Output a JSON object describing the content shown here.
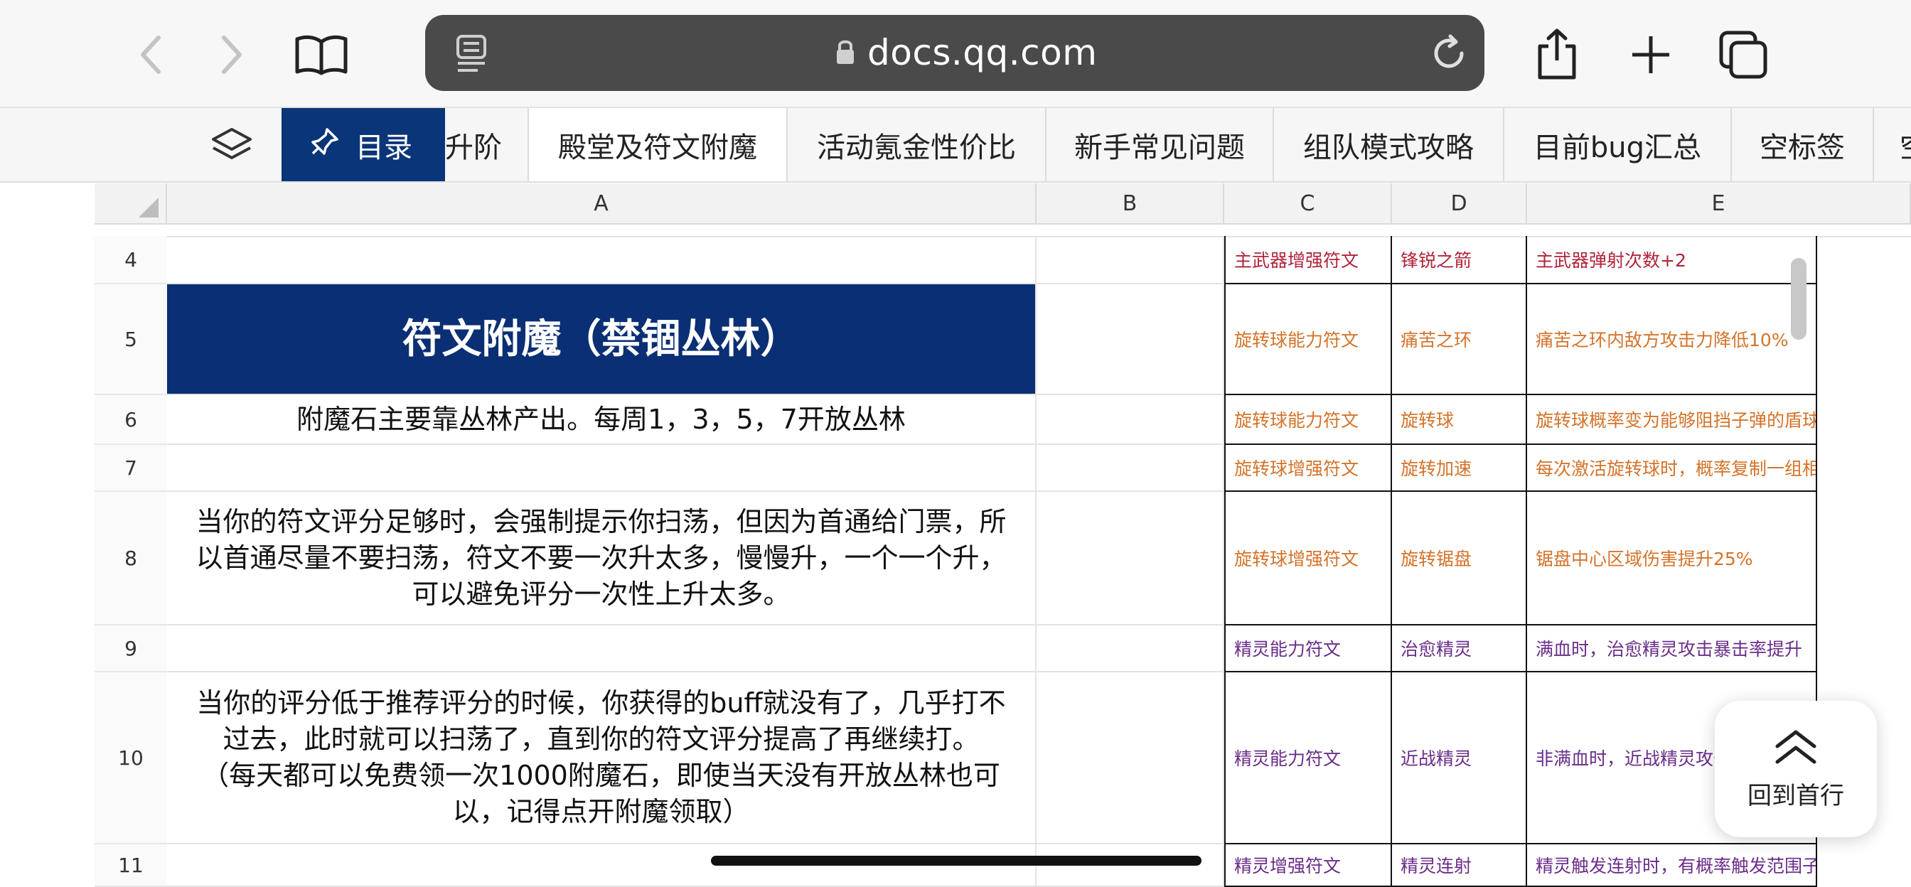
{
  "browser": {
    "url": "docs.qq.com",
    "icons": [
      "back-icon",
      "forward-icon",
      "bookmarks-icon",
      "reader-icon",
      "lock-icon",
      "reload-icon",
      "share-icon",
      "new-tab-icon",
      "tabs-icon"
    ]
  },
  "tabs": {
    "toc_label": "目录",
    "items": [
      "升阶",
      "殿堂及符文附魔",
      "活动氪金性价比",
      "新手常见问题",
      "组队模式攻略",
      "目前bug汇总",
      "空标签",
      "空"
    ]
  },
  "columns": [
    "A",
    "B",
    "C",
    "D",
    "E"
  ],
  "rows": [
    {
      "num": "4",
      "a": "",
      "c": "主武器增强符文",
      "d": "锋锐之箭",
      "e": "主武器弹射次数+2",
      "color": "#b0243a"
    },
    {
      "num": "5",
      "a": "符文附魔（禁锢丛林）",
      "c": "旋转球能力符文",
      "d": "痛苦之环",
      "e": "痛苦之环内敌方攻击力降低10%",
      "color": "#d4732a"
    },
    {
      "num": "6",
      "a": "附魔石主要靠丛林产出。每周1，3，5，7开放丛林",
      "c": "旋转球能力符文",
      "d": "旋转球",
      "e": "旋转球概率变为能够阻挡子弹的盾球",
      "color": "#d4732a"
    },
    {
      "num": "7",
      "a": "",
      "c": "旋转球增强符文",
      "d": "旋转加速",
      "e": "每次激活旋转球时，概率复制一组相同的旋转球",
      "color": "#d4732a"
    },
    {
      "num": "8",
      "a": "当你的符文评分足够时，会强制提示你扫荡，但因为首通给门票，所以首通尽量不要扫荡，符文不要一次升太多，慢慢升，一个一个升，可以避免评分一次性上升太多。",
      "c": "旋转球增强符文",
      "d": "旋转锯盘",
      "e": "锯盘中心区域伤害提升25%",
      "color": "#d4732a"
    },
    {
      "num": "9",
      "a": "",
      "c": "精灵能力符文",
      "d": "治愈精灵",
      "e": "满血时，治愈精灵攻击暴击率提升",
      "color": "#6a2d8a"
    },
    {
      "num": "10",
      "a": "当你的评分低于推荐评分的时候，你获得的buff就没有了，几乎打不过去，此时就可以扫荡了，直到你的符文评分提高了再继续打。\n（每天都可以免费领一次1000附魔石，即使当天没有开放丛林也可以，记得点开附魔领取）",
      "c": "精灵能力符文",
      "d": "近战精灵",
      "e": "非满血时，近战精灵攻击力提升",
      "color": "#6a2d8a"
    },
    {
      "num": "11",
      "a": "",
      "c": "精灵增强符文",
      "d": "精灵连射",
      "e": "精灵触发连射时，有概率触发范围子弹",
      "color": "#6a2d8a"
    }
  ],
  "back_to_top": "回到首行"
}
